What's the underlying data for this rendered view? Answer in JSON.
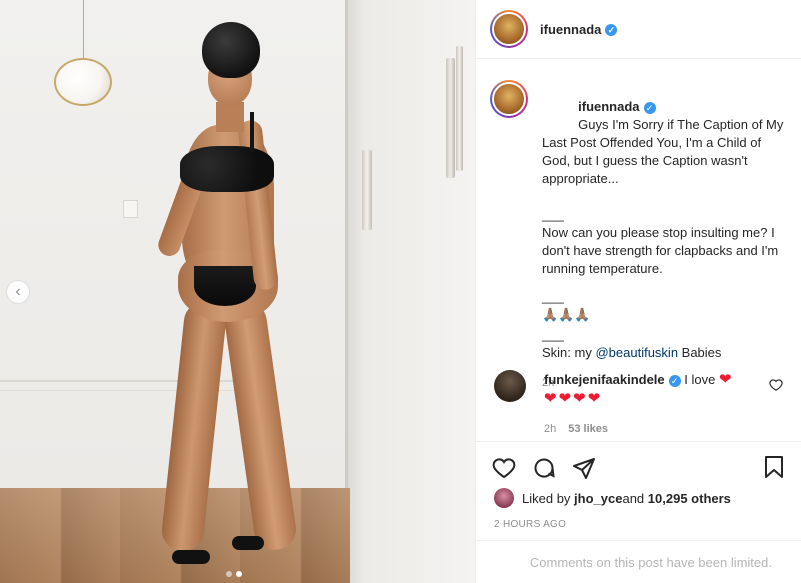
{
  "post": {
    "username": "ifuennada",
    "verified_icon": "verified-badge-icon"
  },
  "caption": {
    "username": "ifuennada",
    "line1": "Guys I'm Sorry if The Caption of My Last Post Offended You, I'm a Child of God, but I guess the Caption wasn't appropriate...",
    "sep1": "___",
    "line2": "Now can you please stop insulting me? I don't have strength for clapbacks and I'm running temperature.",
    "sep2": "___",
    "emojis": "🙏🏽🙏🏽🙏🏽",
    "sep3": "___",
    "skin_prefix": "Skin: my ",
    "mention": "@beautifuskin",
    "skin_suffix": " Babies",
    "time": "2h"
  },
  "comment": {
    "username": "funkejenifaakindele",
    "text": " I love ",
    "hearts_inline": "❤",
    "hearts_row": "❤❤❤❤",
    "time": "2h",
    "likes": "53 likes"
  },
  "actions": {
    "like_icon": "heart-icon",
    "comment_icon": "comment-icon",
    "share_icon": "share-icon",
    "save_icon": "bookmark-icon"
  },
  "likes": {
    "prefix": "Liked by ",
    "user": "jho_yce",
    "middle": " and ",
    "others": "10,295 others"
  },
  "posted": "2 HOURS AGO",
  "comments_limited": "Comments on this post have been limited.",
  "carousel": {
    "total": 2,
    "current": 2
  },
  "colors": {
    "verified": "#3897f0",
    "mention": "#00376b",
    "heart": "#ed1b33",
    "muted": "#8e8e8e"
  }
}
